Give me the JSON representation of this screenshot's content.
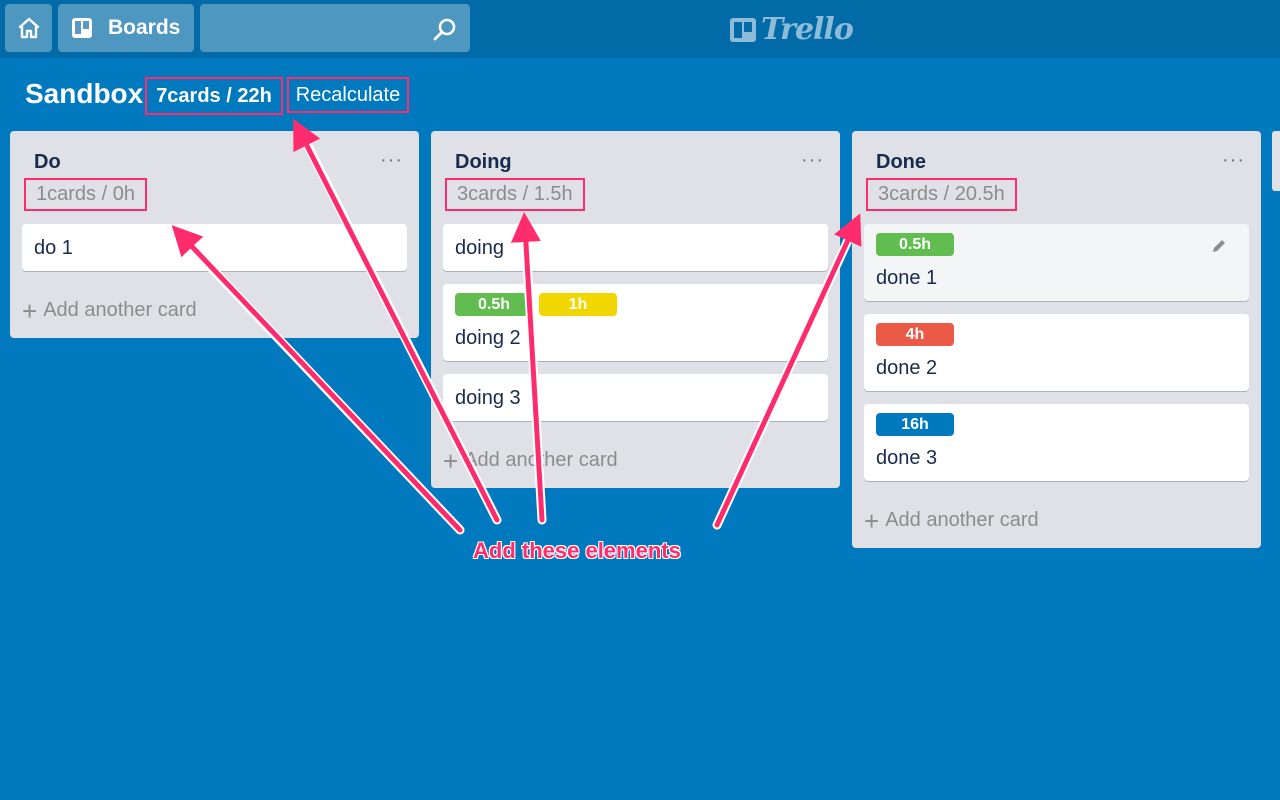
{
  "header": {
    "boards_label": "Boards",
    "search_value": "",
    "logo_text": "Trello",
    "icons": [
      "home-icon",
      "boards-icon",
      "search-icon",
      "trello-logo-icon"
    ]
  },
  "board": {
    "title": "Sandbox",
    "stats": "7cards / 22h",
    "recalculate_label": "Recalculate"
  },
  "lists": [
    {
      "name": "Do",
      "menu": "···",
      "stats": "1cards / 0h",
      "cards": [
        {
          "title": "do 1",
          "labels": []
        }
      ],
      "add_card": "Add another card"
    },
    {
      "name": "Doing",
      "menu": "···",
      "stats": "3cards / 1.5h",
      "cards": [
        {
          "title": "doing",
          "labels": []
        },
        {
          "title": "doing 2",
          "labels": [
            {
              "text": "0.5h",
              "color": "#61bd4f"
            },
            {
              "text": "1h",
              "color": "#f2d600"
            }
          ]
        },
        {
          "title": "doing 3",
          "labels": []
        }
      ],
      "add_card": "Add another card"
    },
    {
      "name": "Done",
      "menu": "···",
      "stats": "3cards / 20.5h",
      "cards": [
        {
          "title": "done 1",
          "labels": [
            {
              "text": "0.5h",
              "color": "#61bd4f"
            }
          ]
        },
        {
          "title": "done 2",
          "labels": [
            {
              "text": "4h",
              "color": "#eb5a46"
            }
          ]
        },
        {
          "title": "done 3",
          "labels": [
            {
              "text": "16h",
              "color": "#0079bf"
            }
          ]
        }
      ],
      "add_card": "Add another card"
    }
  ],
  "annotation": {
    "text": "Add these elements",
    "color": "#ff2c6d"
  },
  "colors": {
    "background": "#0079bf",
    "header": "#026aa7",
    "list_bg": "#dfe1e6",
    "highlight": "#ff2c6d"
  }
}
